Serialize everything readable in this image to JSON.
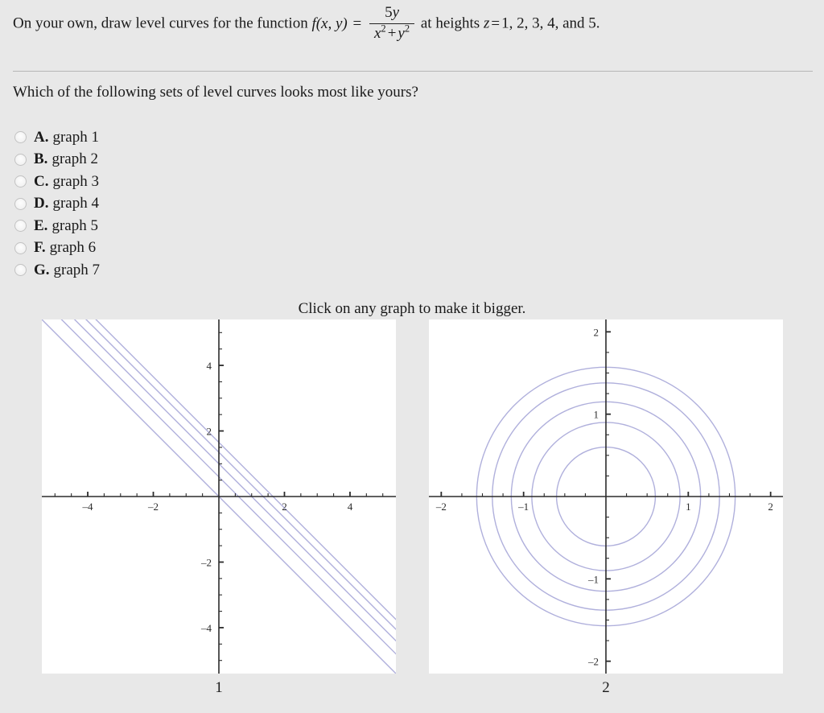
{
  "statement": {
    "lead": "On your own, draw level curves for the function",
    "function_name": "f",
    "function_args": "(x, y)",
    "equals": "=",
    "numerator": "5y",
    "denominator": "x² + y²",
    "numerator_coeff": "5",
    "numerator_var": "y",
    "den_var1": "x",
    "den_exp1": "2",
    "den_plus": "+",
    "den_var2": "y",
    "den_exp2": "2",
    "mid": "at heights",
    "z_var": "z",
    "z_equals": "=",
    "heights": "1, 2, 3, 4, and 5."
  },
  "question": "Which of the following sets of level curves looks most like yours?",
  "choices": [
    {
      "letter": "A.",
      "label": "graph 1",
      "selected": false
    },
    {
      "letter": "B.",
      "label": "graph 2",
      "selected": false
    },
    {
      "letter": "C.",
      "label": "graph 3",
      "selected": false
    },
    {
      "letter": "D.",
      "label": "graph 4",
      "selected": false
    },
    {
      "letter": "E.",
      "label": "graph 5",
      "selected": false
    },
    {
      "letter": "F.",
      "label": "graph 6",
      "selected": false
    },
    {
      "letter": "G.",
      "label": "graph 7",
      "selected": false
    }
  ],
  "click_hint": "Click on any graph to make it bigger.",
  "captions": {
    "graph1": "1",
    "graph2": "2"
  },
  "colors": {
    "page_background": "#e8e8e8",
    "panel_background": "#ffffff",
    "curve": "#b0b0dc",
    "axis": "#2b2b2b",
    "divider": "#b6b6b6",
    "text": "#1a1a1a"
  },
  "chart_data": [
    {
      "type": "line",
      "title": "1",
      "xlabel": "",
      "ylabel": "",
      "xlim": [
        -5.4,
        5.4
      ],
      "ylim": [
        -5.4,
        5.4
      ],
      "grid": false,
      "legend": "none",
      "xticks_labeled": [
        -4,
        -2,
        2,
        4
      ],
      "yticks_labeled": [
        -4,
        -2,
        2,
        4
      ],
      "tick_step": 0.5,
      "description": "Five parallel straight lines of slope -1",
      "series": [
        {
          "name": "line 1",
          "slope": -1,
          "intercept": 0.0
        },
        {
          "name": "line 2",
          "slope": -1,
          "intercept": 0.6
        },
        {
          "name": "line 3",
          "slope": -1,
          "intercept": 1.0
        },
        {
          "name": "line 4",
          "slope": -1,
          "intercept": 1.35
        },
        {
          "name": "line 5",
          "slope": -1,
          "intercept": 1.65
        }
      ]
    },
    {
      "type": "line",
      "title": "2",
      "xlabel": "",
      "ylabel": "",
      "xlim": [
        -2.15,
        2.15
      ],
      "ylim": [
        -2.15,
        2.15
      ],
      "grid": false,
      "legend": "none",
      "xticks_labeled": [
        -2,
        -1,
        1,
        2
      ],
      "yticks_labeled": [
        -2,
        -1,
        1,
        2
      ],
      "tick_step": 0.25,
      "description": "Five concentric circles centered at the origin",
      "series": [
        {
          "name": "circle 1",
          "cx": 0,
          "cy": 0,
          "r": 0.6
        },
        {
          "name": "circle 2",
          "cx": 0,
          "cy": 0,
          "r": 0.9
        },
        {
          "name": "circle 3",
          "cx": 0,
          "cy": 0,
          "r": 1.15
        },
        {
          "name": "circle 4",
          "cx": 0,
          "cy": 0,
          "r": 1.38
        },
        {
          "name": "circle 5",
          "cx": 0,
          "cy": 0,
          "r": 1.57
        }
      ]
    }
  ]
}
